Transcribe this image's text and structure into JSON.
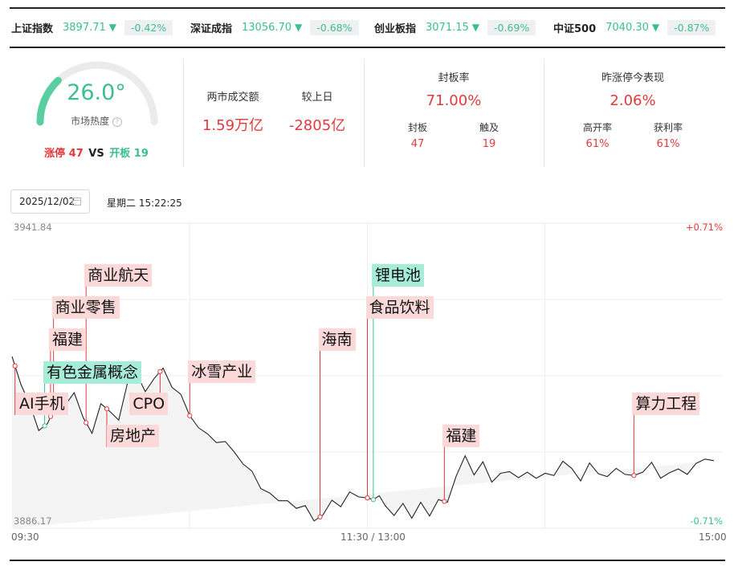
{
  "indices": [
    {
      "name": "上证指数",
      "value": "3897.71",
      "arrow": "▼",
      "change": "-0.42%"
    },
    {
      "name": "深证成指",
      "value": "13056.70",
      "arrow": "▼",
      "change": "-0.68%"
    },
    {
      "name": "创业板指",
      "value": "3071.15",
      "arrow": "▼",
      "change": "-0.69%"
    },
    {
      "name": "中证500",
      "value": "7040.30",
      "arrow": "▼",
      "change": "-0.87%"
    }
  ],
  "heat": {
    "value": "26.0°",
    "label": "市场热度",
    "level": 0.26,
    "limit_up_label": "涨停",
    "limit_up_count": "47",
    "vs": "VS",
    "open_label": "开板",
    "open_count": "19"
  },
  "turnover": {
    "label": "两市成交额",
    "value": "1.59万亿",
    "diff_label": "较上日",
    "diff_value": "-2805亿"
  },
  "seal": {
    "label": "封板率",
    "value": "71.00%",
    "sealed_label": "封板",
    "sealed_value": "47",
    "touched_label": "触及",
    "touched_value": "19"
  },
  "yesterday": {
    "label": "昨涨停今表现",
    "value": "2.06%",
    "high_open_label": "高开率",
    "high_open_value": "61%",
    "profit_label": "获利率",
    "profit_value": "61%"
  },
  "date_picker": {
    "value": "2025/12/02"
  },
  "datetime": "星期二 15:22:25",
  "colors": {
    "up": "#e4393c",
    "down": "#3bbf8f",
    "tag_red": "#fbd9d9",
    "tag_green": "#a6ecd6"
  },
  "chart_data": {
    "type": "line",
    "title": "",
    "y_max": "3941.84",
    "y_min": "3886.17",
    "pct_max": "+0.71%",
    "pct_min": "-0.71%",
    "ylim": [
      3886.17,
      3941.84
    ],
    "x_ticks": [
      "09:30",
      "11:30 / 13:00",
      "15:00"
    ],
    "total_minutes": 240,
    "series": [
      {
        "t": [
          0,
          3,
          6,
          9,
          12,
          15,
          18,
          21,
          24,
          27,
          30,
          33,
          36,
          39,
          42,
          45,
          48,
          51,
          54,
          57,
          60,
          63,
          66,
          69,
          72,
          75,
          78,
          81,
          84,
          87,
          90,
          93,
          96,
          99,
          102,
          105,
          108,
          111,
          114,
          117,
          120,
          122,
          124,
          126,
          129,
          132,
          135,
          138,
          141,
          144,
          147,
          150,
          153,
          156,
          159,
          162,
          165,
          168,
          171,
          174,
          177,
          180,
          183,
          186,
          189,
          192,
          195,
          198,
          201,
          204,
          207,
          210,
          213,
          216,
          219,
          222,
          225,
          228,
          231,
          234,
          237,
          240
        ],
        "v": [
          3917.5,
          3912.4,
          3908.8,
          3904.0,
          3905.3,
          3909.1,
          3908.7,
          3910.9,
          3906.4,
          3903.5,
          3908.9,
          3907.5,
          3905.9,
          3912.7,
          3914.4,
          3911.1,
          3913.5,
          3915.4,
          3911.9,
          3910.6,
          3906.7,
          3904.5,
          3903.4,
          3901.8,
          3902.0,
          3900.1,
          3897.9,
          3896.6,
          3893.4,
          3892.6,
          3891.2,
          3891.2,
          3889.8,
          3890.3,
          3887.5,
          3888.6,
          3891.3,
          3890.1,
          3892.8,
          3891.9,
          3891.7,
          3891.4,
          3892.1,
          3890.3,
          3888.5,
          3890.7,
          3888.0,
          3890.9,
          3888.4,
          3891.4,
          3890.9,
          3895.7,
          3899.4,
          3895.9,
          3898.3,
          3894.6,
          3896.2,
          3896.5,
          3895.4,
          3896.4,
          3895.3,
          3896.2,
          3895.8,
          3898.4,
          3897.1,
          3894.8,
          3898.1,
          3896.1,
          3895.6,
          3897.1,
          3896.0,
          3895.8,
          3896.4,
          3898.2,
          3895.3,
          3896.3,
          3897.0,
          3896.0,
          3898.0,
          3898.8,
          3898.5
        ]
      }
    ],
    "annotations": [
      {
        "label": "AI手机",
        "t": 1,
        "color": "red"
      },
      {
        "label": "有色金属概念",
        "t": 11,
        "color": "green"
      },
      {
        "label": "福建",
        "t": 13,
        "color": "red"
      },
      {
        "label": "商业零售",
        "t": 14,
        "color": "red"
      },
      {
        "label": "商业航天",
        "t": 25,
        "color": "red"
      },
      {
        "label": "房地产",
        "t": 32,
        "color": "red"
      },
      {
        "label": "CPO",
        "t": 50,
        "color": "red"
      },
      {
        "label": "冰雪产业",
        "t": 60,
        "color": "red"
      },
      {
        "label": "海南",
        "t": 104,
        "color": "red"
      },
      {
        "label": "食品饮料",
        "t": 120,
        "color": "red"
      },
      {
        "label": "锂电池",
        "t": 122,
        "color": "green"
      },
      {
        "label": "福建",
        "t": 146,
        "color": "red"
      },
      {
        "label": "算力工程",
        "t": 210,
        "color": "red"
      }
    ]
  }
}
